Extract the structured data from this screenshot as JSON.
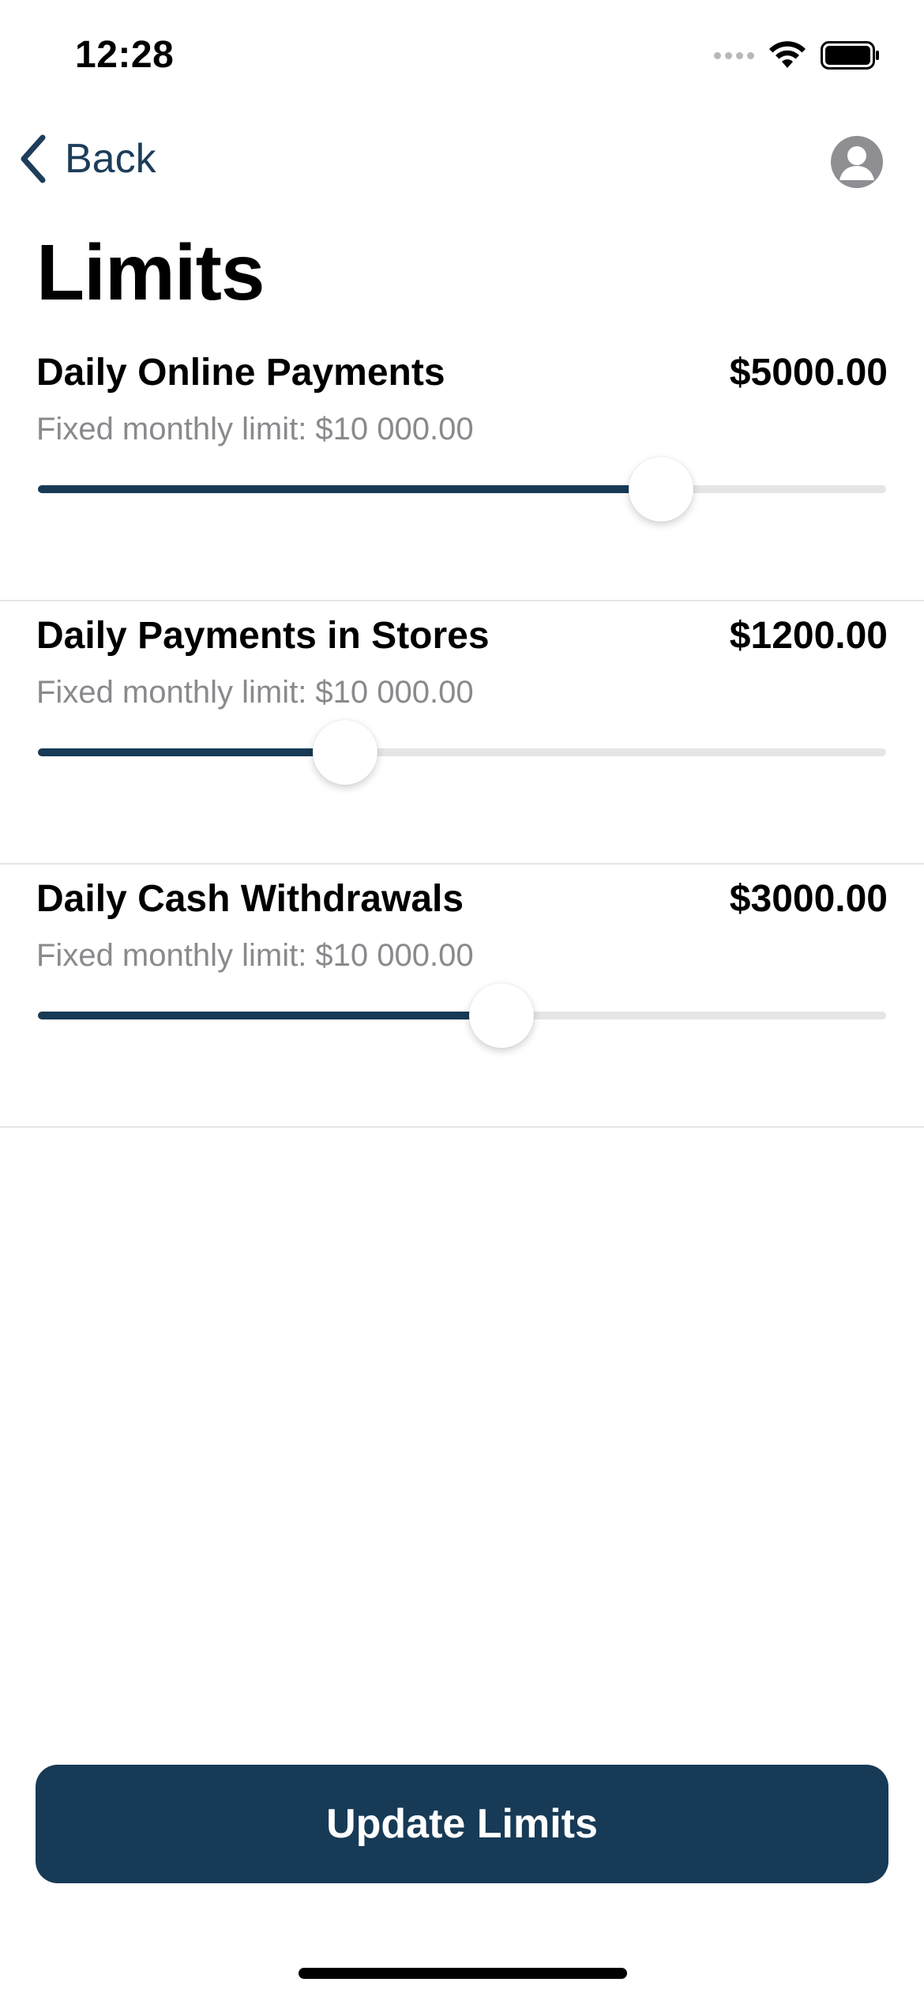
{
  "status_bar": {
    "time": "12:28",
    "icons": [
      "cellular-signal-icon",
      "wifi-icon",
      "battery-icon"
    ]
  },
  "nav": {
    "back_label": "Back",
    "back_icon": "chevron-left-icon",
    "profile_icon": "person-icon"
  },
  "page": {
    "title": "Limits"
  },
  "limits": [
    {
      "name": "Daily Online Payments",
      "value": "$5000.00",
      "subtitle": "Fixed monthly limit: $10 000.00",
      "slider_fraction": 0.735
    },
    {
      "name": "Daily Payments in Stores",
      "value": "$1200.00",
      "subtitle": "Fixed monthly limit: $10 000.00",
      "slider_fraction": 0.362
    },
    {
      "name": "Daily Cash Withdrawals",
      "value": "$3000.00",
      "subtitle": "Fixed monthly limit: $10 000.00",
      "slider_fraction": 0.547
    }
  ],
  "actions": {
    "update_label": "Update Limits"
  },
  "colors": {
    "accent": "#183a56",
    "nav_text": "#1d3d5a",
    "secondary_text": "#8a8a8e",
    "track": "#e5e5e5"
  }
}
